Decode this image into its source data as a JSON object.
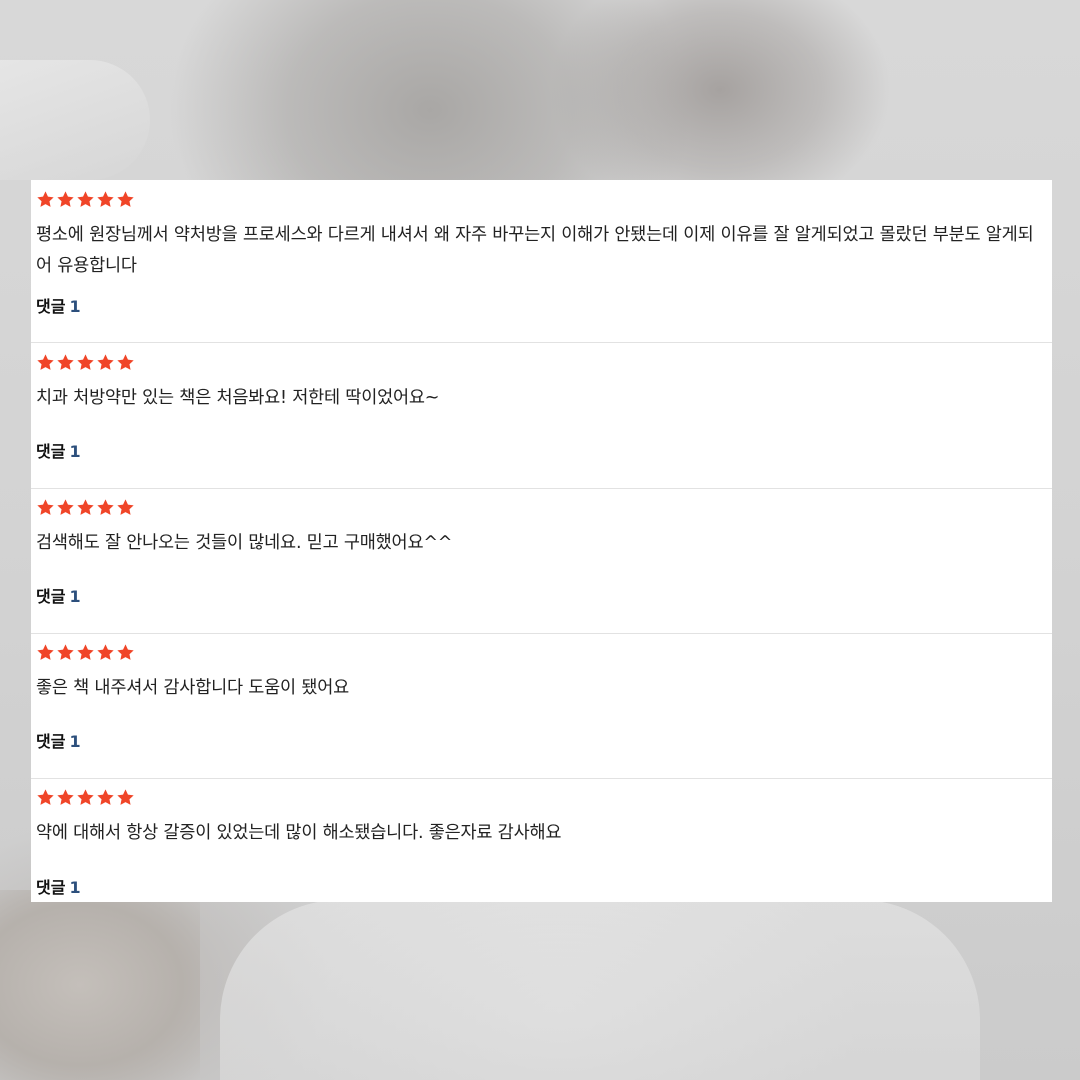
{
  "colors": {
    "star": "#f04528",
    "comment_count": "#2c4f7c",
    "divider": "#e2e2e2",
    "panel_background": "#ffffff"
  },
  "reviews": [
    {
      "rating": 5,
      "text": "평소에 원장님께서 약처방을 프로세스와 다르게 내셔서 왜 자주 바꾸는지 이해가 안됐는데 이제 이유를 잘 알게되었고 몰랐던 부분도 알게되어 유용합니다",
      "comment_label": "댓글",
      "comment_count": "1"
    },
    {
      "rating": 5,
      "text": "치과 처방약만 있는 책은 처음봐요! 저한테 딱이었어요~",
      "comment_label": "댓글",
      "comment_count": "1"
    },
    {
      "rating": 5,
      "text": "검색해도 잘 안나오는 것들이 많네요. 믿고 구매했어요^^",
      "comment_label": "댓글",
      "comment_count": "1"
    },
    {
      "rating": 5,
      "text": "좋은 책 내주셔서 감사합니다 도움이 됐어요",
      "comment_label": "댓글",
      "comment_count": "1"
    },
    {
      "rating": 5,
      "text": "약에 대해서 항상 갈증이 있었는데 많이 해소됐습니다. 좋은자료 감사해요",
      "comment_label": "댓글",
      "comment_count": "1"
    }
  ]
}
